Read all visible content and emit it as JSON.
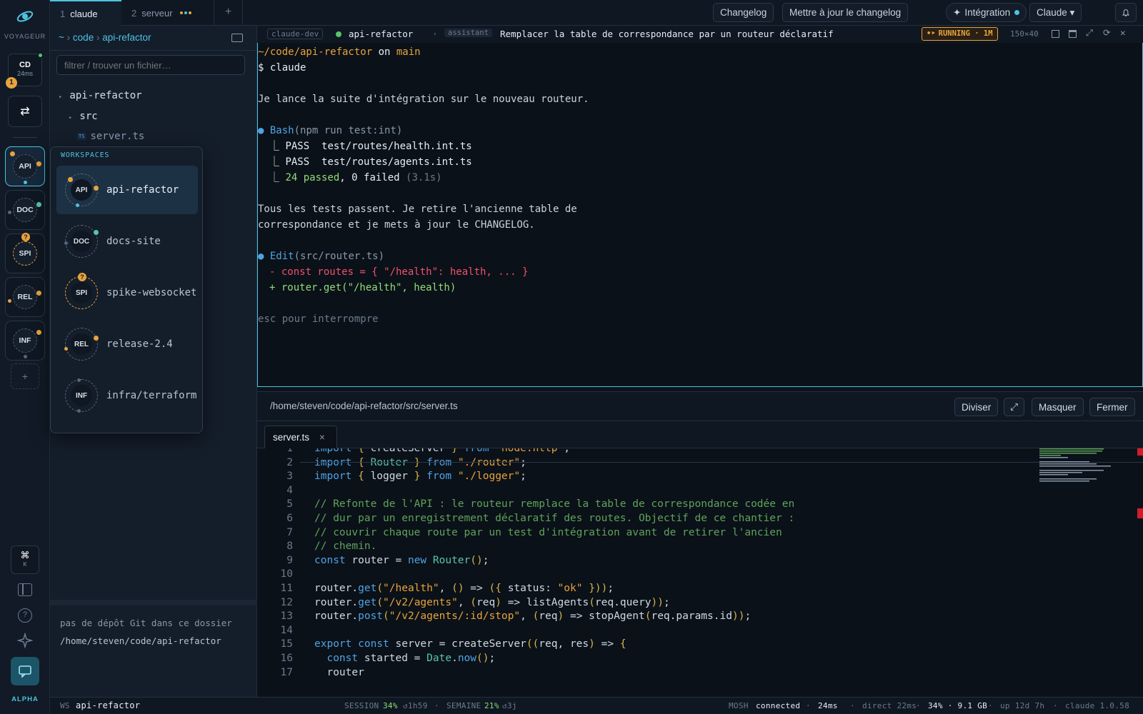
{
  "rail": {
    "brand": "VOYAGEUR",
    "cd_label": "CD",
    "cd_latency": "24ms",
    "cd_badge": "1",
    "switch_glyph": "⇄",
    "workspaces": [
      "API",
      "DOC",
      "SPI",
      "REL",
      "INF"
    ],
    "add_glyph": "+",
    "cmd_glyph": "⌘",
    "cmd_key": "K",
    "footer": "ALPHA"
  },
  "tabs": [
    {
      "num": "1",
      "label": "claude"
    },
    {
      "num": "2",
      "label": "serveur"
    }
  ],
  "tab_add": "+",
  "topbar": {
    "changelog": "Changelog",
    "update_changelog": "Mettre à jour le changelog",
    "integration": "Intégration",
    "claude_select": "Claude ▾"
  },
  "breadcrumb": {
    "home": "~",
    "sep1": "›",
    "dir": "code",
    "sep2": "›",
    "current": "api-refactor"
  },
  "file_filter": {
    "placeholder": "filtrer / trouver un fichier…"
  },
  "tree": {
    "root": "api-refactor",
    "src": "src",
    "file_badge": "TS",
    "file": "server.ts"
  },
  "popover": {
    "title": "WORKSPACES",
    "items": [
      {
        "code": "API",
        "name": "api-refactor"
      },
      {
        "code": "DOC",
        "name": "docs-site"
      },
      {
        "code": "SPI",
        "name": "spike-websocket"
      },
      {
        "code": "REL",
        "name": "release-2.4"
      },
      {
        "code": "INF",
        "name": "infra/terraform"
      }
    ]
  },
  "git_panel": {
    "message": "pas de dépôt Git dans ce dossier",
    "path": "/home/steven/code/api-refactor"
  },
  "term_header": {
    "host": "claude-dev",
    "session": "api-refactor",
    "sep": "·",
    "role": "assistant",
    "task": "Remplacer la table de correspondance par un routeur déclaratif",
    "state": "RUNNING · 1M",
    "size": "150×40"
  },
  "terminal": {
    "prompt_path": "~/code/api-refactor",
    "prompt_on": " on ",
    "prompt_branch": "main",
    "cmd": "$ claude",
    "line1": "Je lance la suite d'intégration sur le nouveau routeur.",
    "bash_bullet": "●",
    "bash_tool": "Bash",
    "bash_arg": "(npm run test:int)",
    "pass1": "PASS  test/routes/health.int.ts",
    "pass2": "PASS  test/routes/agents.int.ts",
    "summary_passed": "24 passed",
    "summary_failed": ", 0 failed",
    "summary_time": " (3.1s)",
    "msg1": "Tous les tests passent. Je retire l'ancienne table de",
    "msg2": "correspondance et je mets à jour le CHANGELOG.",
    "edit_tool": "Edit",
    "edit_arg": "(src/router.ts)",
    "diff_del": "- const routes = { \"/health\": health, ... }",
    "diff_add": "+ router.get(\"/health\", health)",
    "hint": "esc pour interrompre"
  },
  "editor": {
    "path": "/home/steven/code/api-refactor/src/server.ts",
    "split": "Diviser",
    "expand": "⤢",
    "hide": "Masquer",
    "close": "Fermer",
    "tab": "server.ts",
    "tab_close": "×"
  },
  "code_lines": [
    [
      [
        "kw",
        "import "
      ],
      [
        "pu",
        "{ "
      ],
      [
        "va",
        "createServer "
      ],
      [
        "pu",
        "} "
      ],
      [
        "kw",
        "from "
      ],
      [
        "str",
        "\"node:http\""
      ],
      [
        "va",
        ";"
      ]
    ],
    [
      [
        "kw",
        "import "
      ],
      [
        "pu",
        "{ "
      ],
      [
        "ty",
        "Router "
      ],
      [
        "pu",
        "} "
      ],
      [
        "kw",
        "from "
      ],
      [
        "str",
        "\"./router\""
      ],
      [
        "va",
        ";"
      ]
    ],
    [
      [
        "kw",
        "import "
      ],
      [
        "pu",
        "{ "
      ],
      [
        "va",
        "logger "
      ],
      [
        "pu",
        "} "
      ],
      [
        "kw",
        "from "
      ],
      [
        "str",
        "\"./logger\""
      ],
      [
        "va",
        ";"
      ]
    ],
    [],
    [
      [
        "cm",
        "// Refonte de l'API : le routeur remplace la table de correspondance codée en"
      ]
    ],
    [
      [
        "cm",
        "// dur par un enregistrement déclaratif des routes. Objectif de ce chantier :"
      ]
    ],
    [
      [
        "cm",
        "// couvrir chaque route par un test d'intégration avant de retirer l'ancien"
      ]
    ],
    [
      [
        "cm",
        "// chemin."
      ]
    ],
    [
      [
        "kw",
        "const "
      ],
      [
        "va",
        "router = "
      ],
      [
        "kw",
        "new "
      ],
      [
        "ty",
        "Router"
      ],
      [
        "pu",
        "()"
      ],
      [
        "va",
        ";"
      ]
    ],
    [],
    [
      [
        "va",
        "router."
      ],
      [
        "kw",
        "get"
      ],
      [
        "pu",
        "("
      ],
      [
        "str",
        "\"/health\""
      ],
      [
        "va",
        ", "
      ],
      [
        "pu",
        "() "
      ],
      [
        "va",
        "=> "
      ],
      [
        "pu",
        "({ "
      ],
      [
        "va",
        "status: "
      ],
      [
        "str",
        "\"ok\" "
      ],
      [
        "pu",
        "})"
      ],
      [
        "pu",
        ")"
      ],
      [
        "va",
        ";"
      ]
    ],
    [
      [
        "va",
        "router."
      ],
      [
        "kw",
        "get"
      ],
      [
        "pu",
        "("
      ],
      [
        "str",
        "\"/v2/agents\""
      ],
      [
        "va",
        ", "
      ],
      [
        "pu",
        "("
      ],
      [
        "va",
        "req"
      ],
      [
        "pu",
        ") "
      ],
      [
        "va",
        "=> listAgents"
      ],
      [
        "pu",
        "("
      ],
      [
        "va",
        "req.query"
      ],
      [
        "pu",
        "))"
      ],
      [
        "va",
        ";"
      ]
    ],
    [
      [
        "va",
        "router."
      ],
      [
        "kw",
        "post"
      ],
      [
        "pu",
        "("
      ],
      [
        "str",
        "\"/v2/agents/:id/stop\""
      ],
      [
        "va",
        ", "
      ],
      [
        "pu",
        "("
      ],
      [
        "va",
        "req"
      ],
      [
        "pu",
        ") "
      ],
      [
        "va",
        "=> stopAgent"
      ],
      [
        "pu",
        "("
      ],
      [
        "va",
        "req.params.id"
      ],
      [
        "pu",
        "))"
      ],
      [
        "va",
        ";"
      ]
    ],
    [],
    [
      [
        "kw",
        "export const "
      ],
      [
        "va",
        "server = createServer"
      ],
      [
        "pu",
        "(("
      ],
      [
        "va",
        "req, res"
      ],
      [
        "pu",
        ") "
      ],
      [
        "va",
        "=> "
      ],
      [
        "pu",
        "{"
      ]
    ],
    [
      [
        "kw",
        "  const "
      ],
      [
        "va",
        "started = "
      ],
      [
        "ty",
        "Date"
      ],
      [
        "va",
        "."
      ],
      [
        "kw",
        "now"
      ],
      [
        "pu",
        "()"
      ],
      [
        "va",
        ";"
      ]
    ],
    [
      [
        "va",
        "  router"
      ]
    ]
  ],
  "status": {
    "ws_label": "WS",
    "ws": "api-refactor",
    "session_label": "SESSION",
    "session_pct": "34%",
    "session_time": "↺1h59",
    "week_label": "SEMAINE",
    "week_pct": "21%",
    "week_time": "↺3j",
    "mosh_label": "MOSH",
    "mosh": "connected",
    "lat": "24ms",
    "direct": "direct 22ms",
    "mem": "34% · 9.1 GB",
    "uptime": "up 12d 7h",
    "version": "claude 1.0.58",
    "sep": "·"
  },
  "colors": {
    "accent": "#4cc3e0",
    "running": "#e8a33d",
    "green": "#58c46a",
    "red": "#f0506e"
  }
}
